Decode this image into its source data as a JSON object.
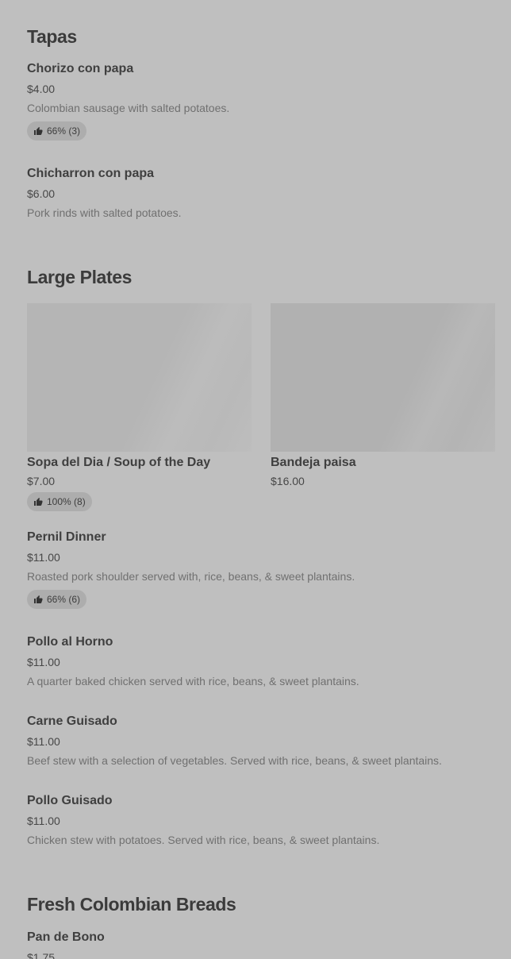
{
  "sections": {
    "tapas": {
      "title": "Tapas",
      "items": [
        {
          "name": "Chorizo con papa",
          "price": "$4.00",
          "description": "Colombian sausage with salted potatoes.",
          "rating": "66% (3)"
        },
        {
          "name": "Chicharron con papa",
          "price": "$6.00",
          "description": "Pork rinds with salted potatoes."
        }
      ]
    },
    "large_plates": {
      "title": "Large Plates",
      "cards": [
        {
          "name": "Sopa del Dia / Soup of the Day",
          "price": "$7.00",
          "rating": "100% (8)"
        },
        {
          "name": "Bandeja paisa",
          "price": "$16.00"
        }
      ],
      "items": [
        {
          "name": "Pernil Dinner",
          "price": "$11.00",
          "description": "Roasted pork shoulder served with, rice, beans, & sweet plantains.",
          "rating": "66% (6)"
        },
        {
          "name": "Pollo al Horno",
          "price": "$11.00",
          "description": "A quarter baked chicken served with rice, beans, & sweet plantains."
        },
        {
          "name": "Carne Guisado",
          "price": "$11.00",
          "description": "Beef stew with a selection of vegetables. Served with rice, beans, & sweet plantains."
        },
        {
          "name": "Pollo Guisado",
          "price": "$11.00",
          "description": "Chicken stew with potatoes. Served with rice, beans, & sweet plantains."
        }
      ]
    },
    "breads": {
      "title": "Fresh Colombian Breads",
      "items": [
        {
          "name": "Pan de Bono",
          "price": "$1.75"
        }
      ]
    }
  },
  "icons": {
    "rating": "thumbs-up-icon"
  },
  "colors": {
    "background": "#bfbfbf",
    "rating_pill": "#adadad",
    "title_text": "#3b3b3b",
    "description_text": "#707070"
  }
}
